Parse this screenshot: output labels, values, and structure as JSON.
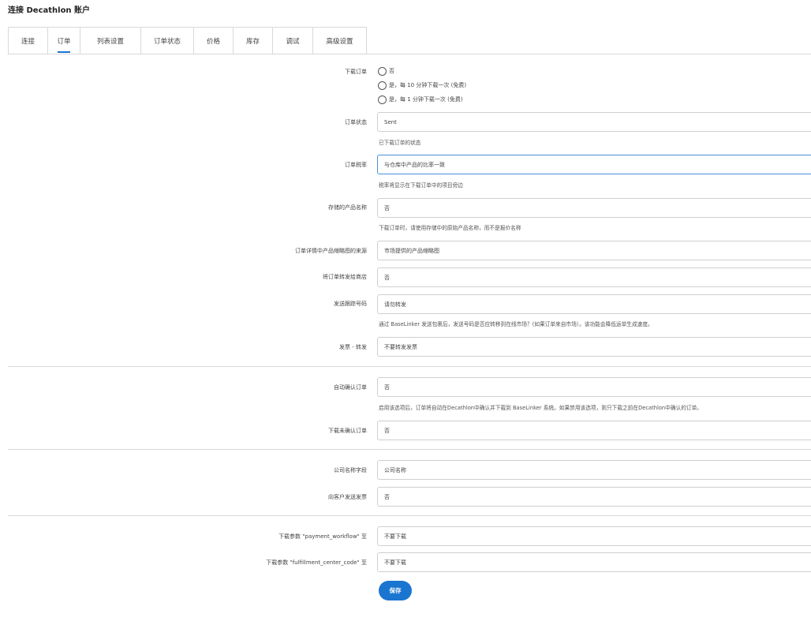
{
  "page_title": "连接 Decathlon 账户",
  "tabs": [
    {
      "label": "连接"
    },
    {
      "label": "订单"
    },
    {
      "label": "列表设置"
    },
    {
      "label": "订单状态"
    },
    {
      "label": "价格"
    },
    {
      "label": "库存"
    },
    {
      "label": "调试"
    },
    {
      "label": "高级设置"
    }
  ],
  "active_tab": "订单",
  "form": {
    "download_orders": {
      "label": "下载订单",
      "options": [
        "否",
        "是，每 10 分钟下载一次 (免费)",
        "是，每 1 分钟下载一次 (免费)"
      ]
    },
    "order_status": {
      "label": "订单状态",
      "value": "Sent",
      "help": "已下载订单的状态"
    },
    "order_tax": {
      "label": "订单税率",
      "value": "与仓库中产品的比率一致",
      "help": "税率将显示在下载订单中的项目旁边"
    },
    "stored_product_name": {
      "label": "存储的产品名称",
      "value": "否",
      "help": "下载订单时，请使用存储中的原始产品名称，而不是报价名称"
    },
    "thumbnail_source": {
      "label": "订单详情中产品缩略图的来源",
      "value": "市场提供的产品缩略图"
    },
    "forward_to_shop": {
      "label": "将订单转发给商店",
      "value": "否"
    },
    "tracking_number": {
      "label": "发送跟踪号码",
      "value": "请勿转发",
      "help": "通过 BaseLinker 发送包裹后，发送号码是否应转移到在线市场？(如果订单来自市场）。该功能会降低运单生成速度。"
    },
    "invoice_forward": {
      "label": "发票 - 转发",
      "value": "不要转发发票"
    },
    "auto_confirm": {
      "label": "自动确认订单",
      "value": "否",
      "help": "启用该选项后，订单将自动在Decathlon中确认并下载到 BaseLinker 系统。如果禁用该选项，则只下载之前在Decathlon中确认的订单。"
    },
    "download_unconfirmed": {
      "label": "下载未确认订单",
      "value": "否"
    },
    "company_field": {
      "label": "公司名称字段",
      "value": "公司名称"
    },
    "send_invoice_customer": {
      "label": "向客户发送发票",
      "value": "否"
    },
    "param_payment_workflow": {
      "label": "下载参数 \"payment_workflow\" 至",
      "value": "不要下载"
    },
    "param_fulfillment": {
      "label": "下载参数 \"fulfillment_center_code\" 至",
      "value": "不要下载"
    }
  },
  "save_button": "保存",
  "colors": {
    "accent": "#1a75d1",
    "border": "#d9d9d9"
  }
}
